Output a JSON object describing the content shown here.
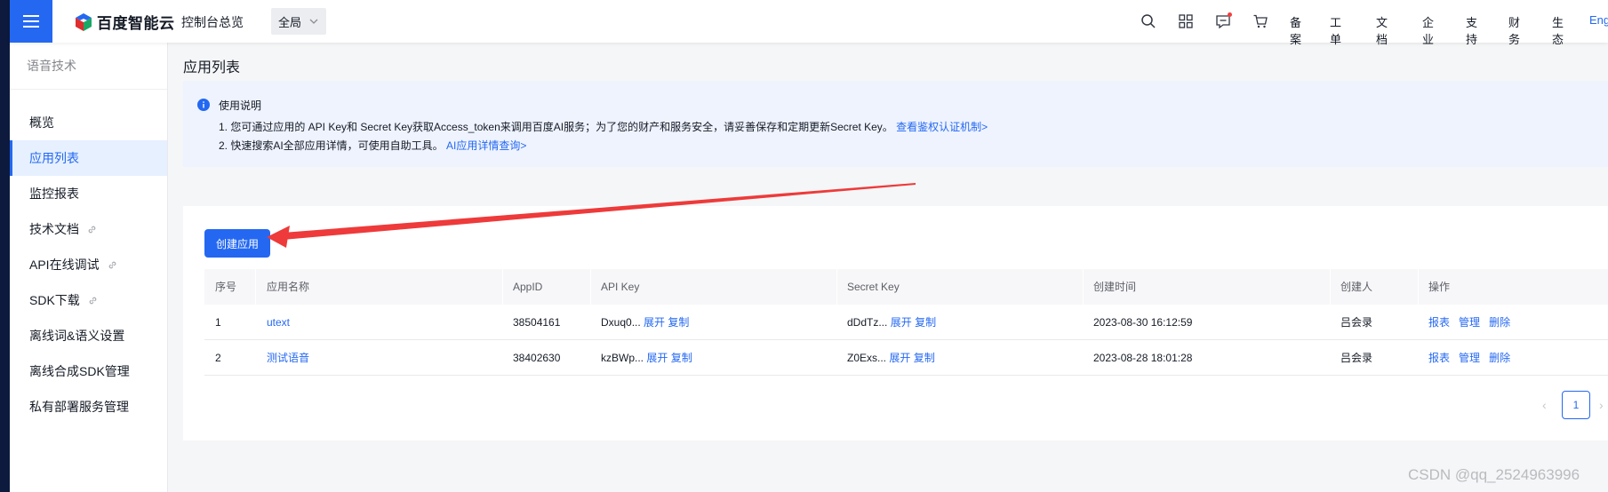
{
  "header": {
    "logo_text": "百度智能云",
    "overview": "控制台总览",
    "region": "全局",
    "icons": [
      "search-icon",
      "apps-grid-icon",
      "message-icon",
      "cart-icon"
    ],
    "links": [
      "备案",
      "工单",
      "文档",
      "企业",
      "支持",
      "财务",
      "生态"
    ],
    "lang": "Eng",
    "brand_color": "#2468f2"
  },
  "sidebar": {
    "title": "语音技术",
    "items": [
      {
        "label": "概览",
        "external": false
      },
      {
        "label": "应用列表",
        "external": false,
        "active": true
      },
      {
        "label": "监控报表",
        "external": false
      },
      {
        "label": "技术文档",
        "external": true
      },
      {
        "label": "API在线调试",
        "external": true
      },
      {
        "label": "SDK下载",
        "external": true
      },
      {
        "label": "离线词&语义设置",
        "external": false
      },
      {
        "label": "离线合成SDK管理",
        "external": false
      },
      {
        "label": "私有部署服务管理",
        "external": false
      }
    ]
  },
  "main": {
    "title": "应用列表",
    "notice": {
      "title": "使用说明",
      "line1_text": "1. 您可通过应用的 API Key和 Secret Key获取Access_token来调用百度AI服务；为了您的财产和服务安全，请妥善保存和定期更新Secret Key。",
      "line1_link": "查看鉴权认证机制>",
      "line2_text": "2. 快速搜索AI全部应用详情，可使用自助工具。",
      "line2_link": "AI应用详情查询>"
    },
    "create_button": "创建应用",
    "table": {
      "headers": [
        "序号",
        "应用名称",
        "AppID",
        "API Key",
        "Secret Key",
        "创建时间",
        "创建人",
        "操作"
      ],
      "rows": [
        {
          "index": "1",
          "name": "utext",
          "app_id": "38504161",
          "api_key": "Dxuq0...",
          "secret_key": "dDdTz...",
          "created": "2023-08-30 16:12:59",
          "creator": "吕会录"
        },
        {
          "index": "2",
          "name": "测试语音",
          "app_id": "38402630",
          "api_key": "kzBWp...",
          "secret_key": "Z0Exs...",
          "created": "2023-08-28 18:01:28",
          "creator": "吕会录"
        }
      ],
      "key_actions": {
        "expand": "展开",
        "copy": "复制"
      },
      "row_actions": {
        "report": "报表",
        "manage": "管理",
        "delete": "删除"
      }
    },
    "pagination": {
      "current_page": "1",
      "prev": "‹",
      "next": "›"
    }
  },
  "watermark": "CSDN @qq_2524963996"
}
